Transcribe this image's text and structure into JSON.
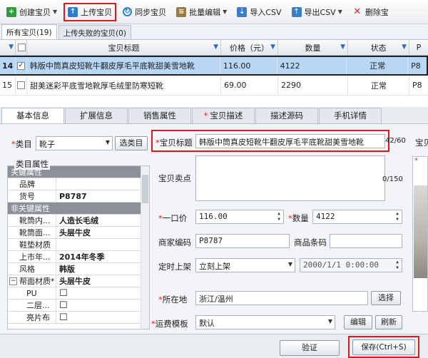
{
  "toolbar": {
    "create": "创建宝贝",
    "upload": "上传宝贝",
    "sync": "同步宝贝",
    "batch_edit": "批量编辑",
    "import_csv": "导入CSV",
    "export_csv": "导出CSV",
    "delete": "删除宝"
  },
  "list_tabs": [
    "所有宝贝(19)",
    "上传失败的宝贝(0)"
  ],
  "grid": {
    "headers": {
      "title": "宝贝标题",
      "price": "价格（元）",
      "qty": "数量",
      "status": "状态",
      "last": "P"
    },
    "rows": [
      {
        "num": "14",
        "checked": "✓",
        "title": "韩版中筒真皮短靴牛翻皮厚毛平底靴甜美雪地靴",
        "price": "116.00",
        "qty": "4122",
        "status": "正常",
        "last": "P8"
      },
      {
        "num": "15",
        "checked": "",
        "title": "甜美迷彩平底雪地靴厚毛绒里防寒短靴",
        "price": "69.00",
        "qty": "2290",
        "status": "正常",
        "last": "P8"
      }
    ]
  },
  "detail_tabs": [
    "基本信息",
    "扩展信息",
    "销售属性",
    "宝贝描述",
    "描述源码",
    "手机详情"
  ],
  "form": {
    "category_label": "类目",
    "category_value": "靴子",
    "choose_category": "选类目",
    "attr_legend": "类目属性",
    "title_label": "宝贝标题",
    "title_value": "韩版中筒真皮短靴牛翻皮厚毛平底靴甜美雪地靴",
    "title_count": "42/60",
    "selling_label": "宝贝卖点",
    "selling_count": "0/150",
    "price_label": "一口价",
    "price_value": "116.00",
    "qty_label": "数量",
    "qty_value": "4122",
    "merchant_code_label": "商家编码",
    "merchant_code_value": "P8787",
    "barcode_label": "商品条码",
    "schedule_label": "定时上架",
    "schedule_value": "立刻上架",
    "schedule_date": "2000/1/1 0:00:00",
    "location_label": "所在地",
    "location_value": "浙江/温州",
    "location_btn": "选择",
    "freight_label": "运费模板",
    "freight_value": "默认",
    "edit_btn": "编辑",
    "refresh_btn": "刷新",
    "right_label": "宝贝"
  },
  "attributes": [
    {
      "type": "group",
      "label": "关键属性"
    },
    {
      "key": "品牌",
      "value": ""
    },
    {
      "key": "货号",
      "value": "P8787"
    },
    {
      "type": "group",
      "label": "非关键属性"
    },
    {
      "key": "靴筒内...",
      "value": "人造长毛绒"
    },
    {
      "key": "靴筒面...",
      "value": "头层牛皮"
    },
    {
      "key": "鞋垫材质",
      "value": ""
    },
    {
      "key": "上市年...",
      "value": "2014年冬季"
    },
    {
      "key": "风格",
      "value": "韩版"
    },
    {
      "key": "帮面材质*",
      "value": "头层牛皮"
    },
    {
      "key": "PU",
      "value": "☐"
    },
    {
      "key": "二层...",
      "value": "☐"
    },
    {
      "key": "亮片布",
      "value": "☐"
    }
  ],
  "footer": {
    "verify": "验证",
    "save": "保存(Ctrl+S)"
  },
  "colors": {
    "highlight_red": "#e01818",
    "selected_row": "#b8d7f5"
  }
}
